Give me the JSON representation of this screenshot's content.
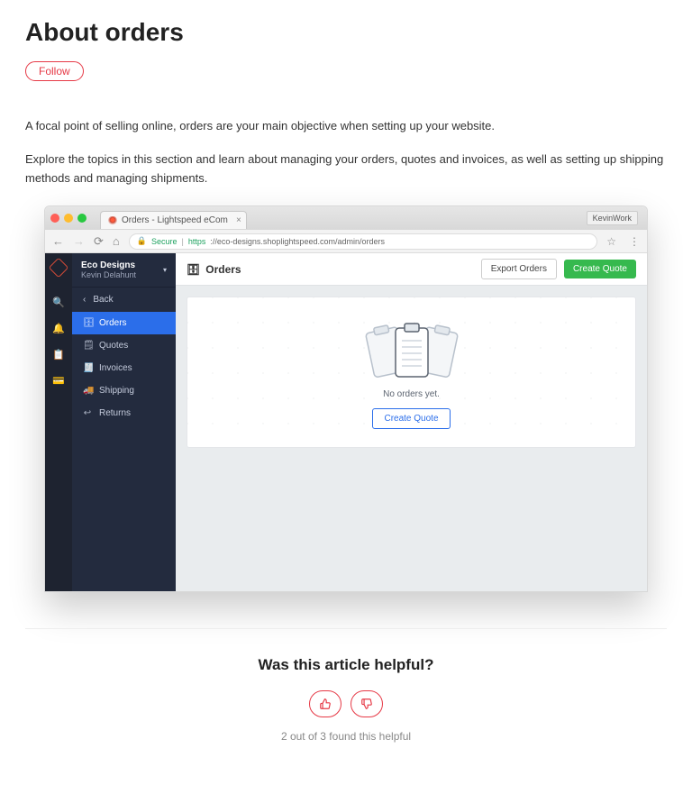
{
  "page": {
    "title": "About orders",
    "follow_label": "Follow",
    "para1": "A focal point of selling online, orders are your main objective when setting up your website.",
    "para2": "Explore the topics in this section and learn about managing your orders, quotes and invoices, as well as setting up shipping methods and managing shipments."
  },
  "browser": {
    "tab_title": "Orders - Lightspeed eCom",
    "profile": "KevinWork",
    "secure_label": "Secure",
    "url_scheme": "https",
    "url_rest": "://eco-designs.shoplightspeed.com/admin/orders"
  },
  "app": {
    "store": "Eco Designs",
    "user": "Kevin Delahunt",
    "back_label": "Back",
    "nav": {
      "orders": "Orders",
      "quotes": "Quotes",
      "invoices": "Invoices",
      "shipping": "Shipping",
      "returns": "Returns"
    },
    "header_title": "Orders",
    "export_label": "Export Orders",
    "create_quote_label": "Create Quote",
    "empty_text": "No orders yet.",
    "empty_cta": "Create Quote"
  },
  "feedback": {
    "title": "Was this article helpful?",
    "count_text": "2 out of 3 found this helpful"
  }
}
